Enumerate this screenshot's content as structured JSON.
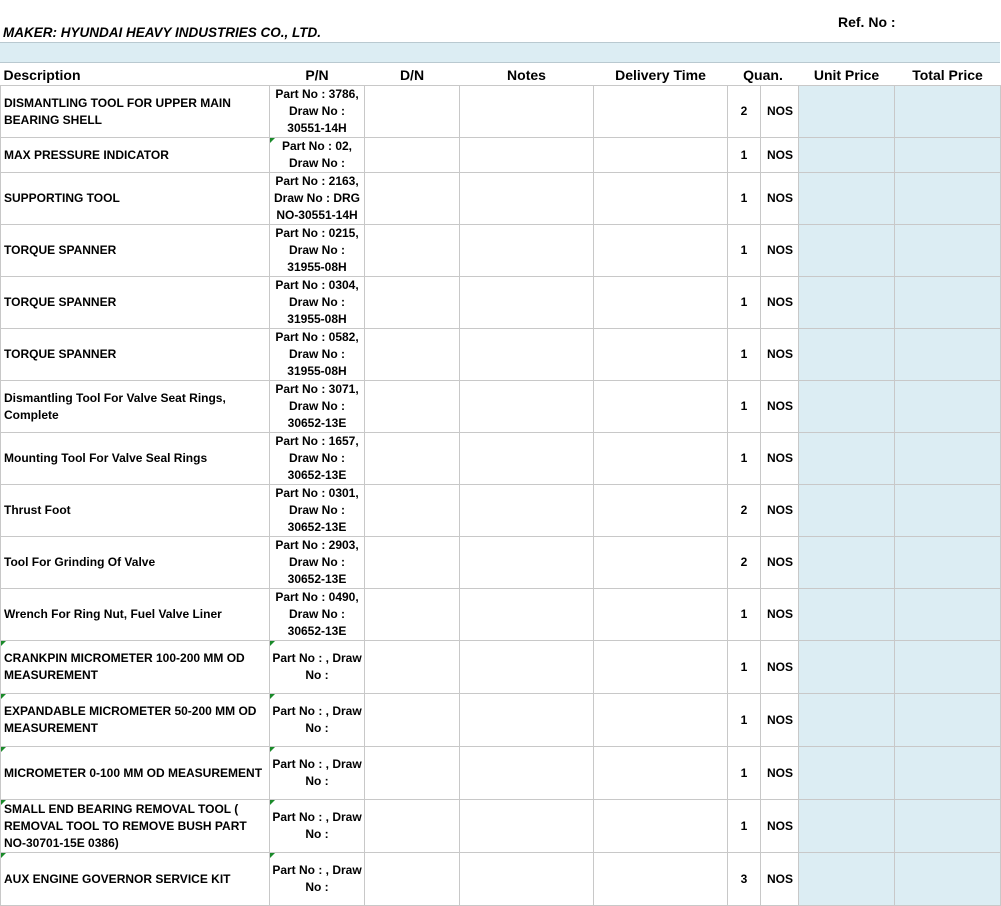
{
  "header": {
    "ref_label": "Ref. No :",
    "maker": "MAKER: HYUNDAI HEAVY INDUSTRIES CO., LTD."
  },
  "columns": {
    "description": "Description",
    "pn": "P/N",
    "dn": "D/N",
    "notes": "Notes",
    "delivery_time": "Delivery Time",
    "quan": "Quan.",
    "unit_price": "Unit Price",
    "total_price": "Total Price"
  },
  "rows": [
    {
      "description": "DISMANTLING TOOL FOR UPPER MAIN BEARING SHELL",
      "pn": "Part No : 3786, Draw No : 30551-14H",
      "qty": "2",
      "unit": "NOS"
    },
    {
      "description": "MAX PRESSURE INDICATOR",
      "pn": "Part No : 02, Draw No :",
      "qty": "1",
      "unit": "NOS"
    },
    {
      "description": "SUPPORTING TOOL",
      "pn": "Part No : 2163, Draw No : DRG NO-30551-14H",
      "qty": "1",
      "unit": "NOS"
    },
    {
      "description": "TORQUE SPANNER",
      "pn": "Part No : 0215, Draw No : 31955-08H",
      "qty": "1",
      "unit": "NOS"
    },
    {
      "description": "TORQUE SPANNER",
      "pn": "Part No : 0304, Draw No : 31955-08H",
      "qty": "1",
      "unit": "NOS"
    },
    {
      "description": "TORQUE SPANNER",
      "pn": "Part No : 0582, Draw No : 31955-08H",
      "qty": "1",
      "unit": "NOS"
    },
    {
      "description": "Dismantling Tool For Valve Seat Rings, Complete",
      "pn": "Part No : 3071, Draw No : 30652-13E",
      "qty": "1",
      "unit": "NOS"
    },
    {
      "description": "Mounting Tool For Valve Seal Rings",
      "pn": "Part No : 1657, Draw No : 30652-13E",
      "qty": "1",
      "unit": "NOS"
    },
    {
      "description": "Thrust Foot",
      "pn": "Part No : 0301, Draw No : 30652-13E",
      "qty": "2",
      "unit": "NOS"
    },
    {
      "description": "Tool For Grinding Of Valve",
      "pn": "Part No : 2903, Draw No : 30652-13E",
      "qty": "2",
      "unit": "NOS"
    },
    {
      "description": "Wrench For Ring Nut, Fuel Valve Liner",
      "pn": "Part No : 0490, Draw No : 30652-13E",
      "qty": "1",
      "unit": "NOS"
    },
    {
      "description": "CRANKPIN MICROMETER 100-200 MM  OD MEASUREMENT",
      "pn": "Part No : , Draw No :",
      "qty": "1",
      "unit": "NOS"
    },
    {
      "description": "EXPANDABLE MICROMETER 50-200 MM  OD MEASUREMENT",
      "pn": "Part No : , Draw No :",
      "qty": "1",
      "unit": "NOS"
    },
    {
      "description": "MICROMETER 0-100 MM  OD MEASUREMENT",
      "pn": "Part No : , Draw No :",
      "qty": "1",
      "unit": "NOS"
    },
    {
      "description": "SMALL END BEARING REMOVAL TOOL ( REMOVAL TOOL TO REMOVE BUSH PART NO-30701-15E 0386)",
      "pn": "Part No : , Draw No :",
      "qty": "1",
      "unit": "NOS"
    },
    {
      "description": "AUX ENGINE GOVERNOR SERVICE KIT",
      "pn": "Part No : , Draw No :",
      "qty": "3",
      "unit": "NOS"
    }
  ]
}
